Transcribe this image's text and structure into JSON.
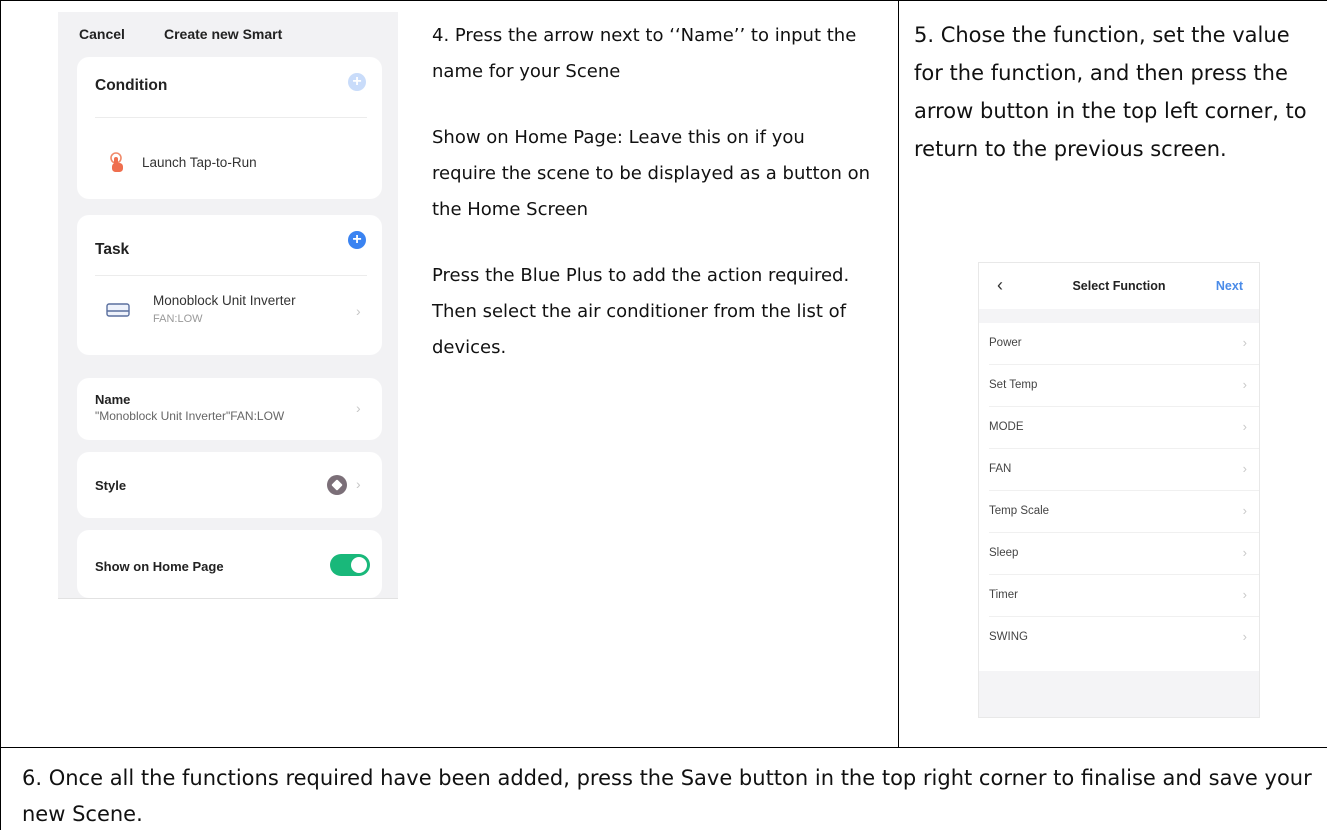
{
  "colors": {
    "accent_blue": "#3a83f1",
    "plus_faded": "#c9dcfa",
    "toggle_green": "#19b87a",
    "next_blue": "#4a8be8"
  },
  "step4": {
    "para1": "4.    Press the arrow next to ‘‘Name’’ to input the name for your Scene",
    "para2": "Show on Home Page: Leave this on if you require the scene to be displayed as a button on the Home Screen",
    "para3": "Press the Blue Plus to add the action required. Then select the air conditioner from the list of devices."
  },
  "step5": {
    "text": "5.        Chose the function, set the value for the function, and then press the arrow button in the top left corner, to return to the previous screen."
  },
  "step6": {
    "text": "6.        Once all the functions required have been added, press the Save button in the top right corner to finalise and save your new Scene."
  },
  "screen_create": {
    "cancel_label": "Cancel",
    "title": "Create new Smart",
    "condition": {
      "heading": "Condition",
      "item_label": "Launch Tap-to-Run",
      "add_icon": "plus-circle-icon",
      "item_icon": "tap-hand-icon"
    },
    "task": {
      "heading": "Task",
      "add_icon": "plus-circle-icon",
      "device_name": "Monoblock Unit Inverter",
      "device_setting": "FAN:LOW",
      "device_icon": "ac-unit-icon"
    },
    "name_row": {
      "label": "Name",
      "value": "\"Monoblock Unit Inverter\"FAN:LOW"
    },
    "style_row": {
      "label": "Style",
      "icon": "tag-icon"
    },
    "home_row": {
      "label": "Show on Home Page",
      "toggle_on": true
    }
  },
  "screen_select": {
    "back_icon": "chevron-left-icon",
    "title": "Select Function",
    "next_label": "Next",
    "functions": [
      "Power",
      "Set Temp",
      "MODE",
      "FAN",
      "Temp Scale",
      "Sleep",
      "Timer",
      "SWING"
    ]
  }
}
